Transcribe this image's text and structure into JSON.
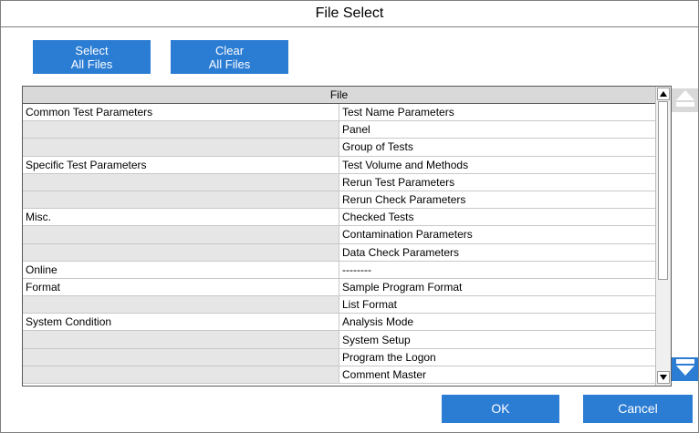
{
  "window": {
    "title": "File Select"
  },
  "toolbar": {
    "select_all": [
      "Select",
      "All Files"
    ],
    "clear_all": [
      "Clear",
      "All Files"
    ]
  },
  "table": {
    "header": "File",
    "rows": [
      {
        "category": "Common Test Parameters",
        "file": "Test Name Parameters"
      },
      {
        "category": "",
        "file": "Panel"
      },
      {
        "category": "",
        "file": "Group of Tests"
      },
      {
        "category": "Specific Test Parameters",
        "file": "Test Volume and Methods"
      },
      {
        "category": "",
        "file": "Rerun Test Parameters"
      },
      {
        "category": "",
        "file": "Rerun Check Parameters"
      },
      {
        "category": "Misc.",
        "file": "Checked Tests"
      },
      {
        "category": "",
        "file": "Contamination Parameters"
      },
      {
        "category": "",
        "file": "Data Check Parameters"
      },
      {
        "category": "Online",
        "file": "--------"
      },
      {
        "category": "Format",
        "file": "Sample Program Format"
      },
      {
        "category": "",
        "file": "List Format"
      },
      {
        "category": "System Condition",
        "file": "Analysis Mode"
      },
      {
        "category": "",
        "file": "System Setup"
      },
      {
        "category": "",
        "file": "Program the Logon"
      },
      {
        "category": "",
        "file": "Comment Master"
      }
    ]
  },
  "footer": {
    "ok": "OK",
    "cancel": "Cancel"
  },
  "icons": {
    "page_up": "arrow-up-icon",
    "page_down": "arrow-down-icon",
    "scroll_up": "scroll-up-icon",
    "scroll_down": "scroll-down-icon"
  },
  "colors": {
    "accent": "#2b7cd3",
    "header_bg": "#d9d9d9",
    "category_bg": "#e6e6e6"
  }
}
